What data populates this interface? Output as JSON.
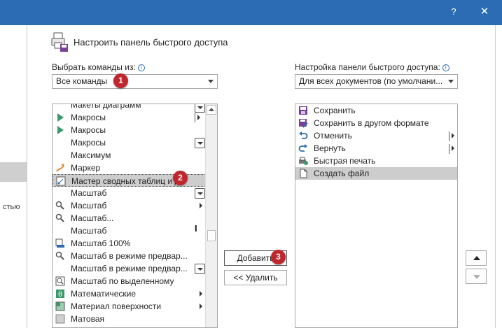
{
  "titlebar": {
    "help": "?",
    "close": "✕"
  },
  "leftnav": {
    "fragment": "стью"
  },
  "dialog": {
    "heading": "Настроить панель быстрого доступа"
  },
  "left": {
    "label": "Выбрать команды из:",
    "info": "i",
    "combo_value": "Все команды",
    "items": [
      {
        "label": "Макеты диаграмм",
        "icon": "none"
      },
      {
        "label": "Макросы",
        "icon": "play-icon"
      },
      {
        "label": "Макросы",
        "icon": "play-icon"
      },
      {
        "label": "Макросы",
        "icon": "none"
      },
      {
        "label": "Максимум",
        "icon": "none"
      },
      {
        "label": "Маркер",
        "icon": "marker-icon"
      },
      {
        "label": "Мастер сводных таблиц и д",
        "icon": "pivot-wizard-icon"
      },
      {
        "label": "Масштаб",
        "icon": "none"
      },
      {
        "label": "Масштаб",
        "icon": "magnifier-icon"
      },
      {
        "label": "Масштаб...",
        "icon": "magnifier-icon"
      },
      {
        "label": "Масштаб",
        "icon": "none"
      },
      {
        "label": "Масштаб 100%",
        "icon": "zoom-100-icon"
      },
      {
        "label": "Масштаб в режиме предвар...",
        "icon": "magnifier-icon"
      },
      {
        "label": "Масштаб в режиме предвар...",
        "icon": "none"
      },
      {
        "label": "Масштаб по выделенному",
        "icon": "zoom-selection-icon"
      },
      {
        "label": "Математические",
        "icon": "math-icon"
      },
      {
        "label": "Материал поверхности",
        "icon": "material-icon"
      },
      {
        "label": "Матовая",
        "icon": "matte-icon"
      }
    ]
  },
  "right": {
    "label": "Настройка панели быстрого доступа:",
    "info": "i",
    "combo_value": "Для всех документов (по умолчани...",
    "items": [
      {
        "label": "Сохранить",
        "icon": "save-icon"
      },
      {
        "label": "Сохранить в другом формате",
        "icon": "save-as-icon"
      },
      {
        "label": "Отменить",
        "icon": "undo-icon"
      },
      {
        "label": "Вернуть",
        "icon": "redo-icon"
      },
      {
        "label": "Быстрая печать",
        "icon": "quick-print-icon"
      },
      {
        "label": "Создать файл",
        "icon": "new-file-icon"
      }
    ]
  },
  "buttons": {
    "add": "Добавить",
    "remove": "<< Удалить"
  },
  "badges": {
    "one": "1",
    "two": "2",
    "three": "3"
  },
  "colors": {
    "titlebar": "#2b6cb4",
    "badge": "#c0272d",
    "selection": "#cdcdcd"
  }
}
